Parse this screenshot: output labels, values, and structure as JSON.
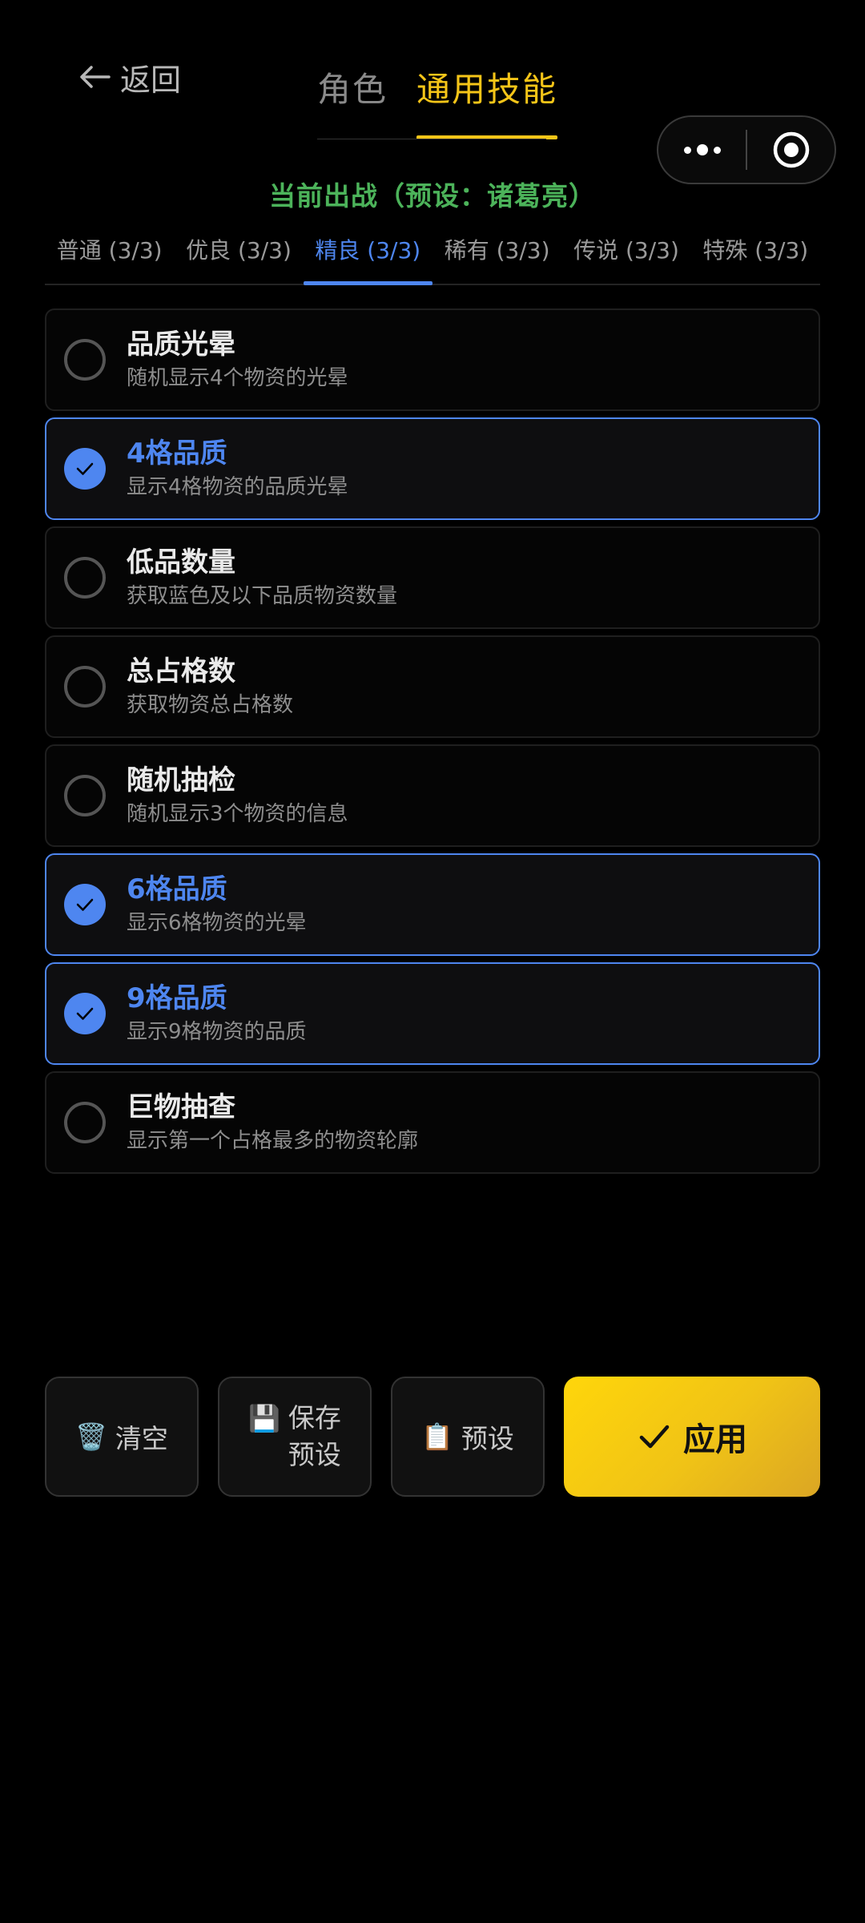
{
  "header": {
    "back_label": "返回",
    "tabs": [
      {
        "label": "角色",
        "active": false
      },
      {
        "label": "通用技能",
        "active": true
      }
    ],
    "preset_line": "当前出战（预设：诸葛亮）"
  },
  "rarity_tabs": [
    {
      "label": "普通 (3/3)",
      "active": false
    },
    {
      "label": "优良 (3/3)",
      "active": false
    },
    {
      "label": "精良 (3/3)",
      "active": true
    },
    {
      "label": "稀有 (3/3)",
      "active": false
    },
    {
      "label": "传说 (3/3)",
      "active": false
    },
    {
      "label": "特殊 (3/3)",
      "active": false
    }
  ],
  "skills": [
    {
      "name": "品质光晕",
      "desc": "随机显示4个物资的光晕",
      "selected": false
    },
    {
      "name": "4格品质",
      "desc": "显示4格物资的品质光晕",
      "selected": true
    },
    {
      "name": "低品数量",
      "desc": "获取蓝色及以下品质物资数量",
      "selected": false
    },
    {
      "name": "总占格数",
      "desc": "获取物资总占格数",
      "selected": false
    },
    {
      "name": "随机抽检",
      "desc": "随机显示3个物资的信息",
      "selected": false
    },
    {
      "name": "6格品质",
      "desc": "显示6格物资的光晕",
      "selected": true
    },
    {
      "name": "9格品质",
      "desc": "显示9格物资的品质",
      "selected": true
    },
    {
      "name": "巨物抽查",
      "desc": "显示第一个占格最多的物资轮廓",
      "selected": false
    }
  ],
  "actions": {
    "clear": {
      "icon": "trash-icon",
      "emoji": "🗑️",
      "label": "清空"
    },
    "save_preset": {
      "icon": "floppy-disk-icon",
      "emoji": "💾",
      "line1": "保存",
      "line2": "预设"
    },
    "preset": {
      "icon": "clipboard-icon",
      "emoji": "📋",
      "label": "预设"
    },
    "apply": {
      "icon": "checkmark-icon",
      "label": "应用"
    }
  },
  "colors": {
    "accent_yellow": "#f5c518",
    "accent_blue": "#4e86f0",
    "accent_green": "#4cb35a"
  }
}
